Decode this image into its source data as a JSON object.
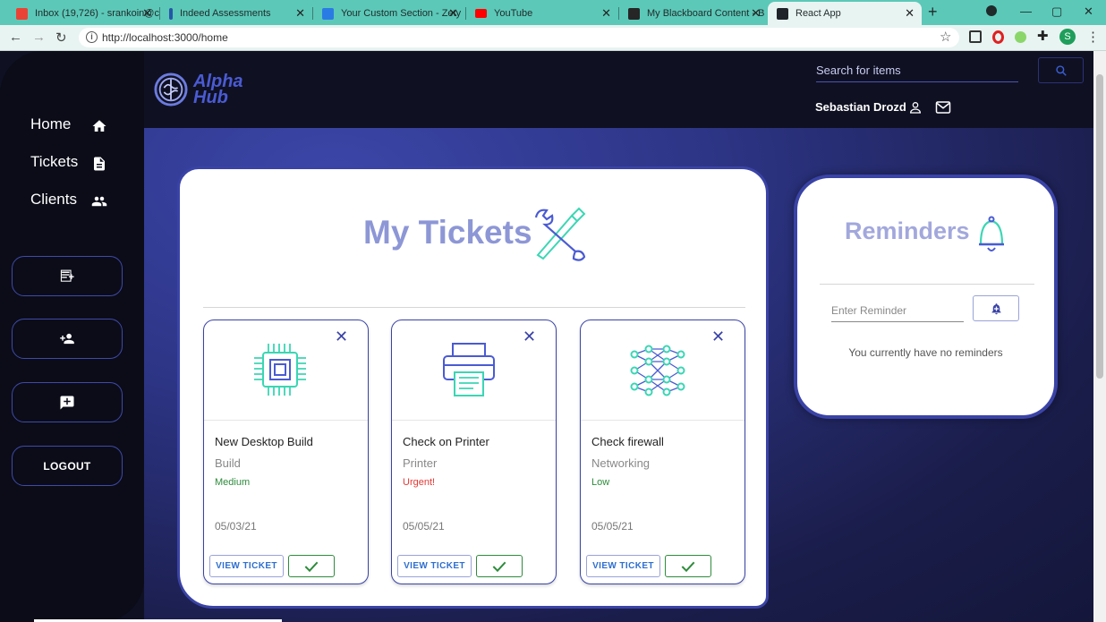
{
  "browser": {
    "tabs": [
      {
        "title": "Inbox (19,726) - srankoin@c",
        "color": "#ea4335"
      },
      {
        "title": "Indeed Assessments",
        "color": "#2557a7"
      },
      {
        "title": "Your Custom Section - Zety",
        "color": "#2b7be4"
      },
      {
        "title": "YouTube",
        "color": "#ff0000"
      },
      {
        "title": "My Blackboard Content - B",
        "color": "#262626"
      },
      {
        "title": "React App",
        "color": "#20232a"
      }
    ],
    "url": "http://localhost:3000/home"
  },
  "sidebar": {
    "items": [
      {
        "label": "Home",
        "icon": "home-icon"
      },
      {
        "label": "Tickets",
        "icon": "document-icon"
      },
      {
        "label": "Clients",
        "icon": "people-icon"
      }
    ],
    "buttons": [
      {
        "icon": "add-note-icon"
      },
      {
        "icon": "add-user-icon"
      },
      {
        "icon": "add-comment-icon"
      }
    ],
    "logout_label": "LOGOUT"
  },
  "header": {
    "logo_line1": "Alpha",
    "logo_line2": "Hub",
    "search_placeholder": "Search for items",
    "user_name": "Sebastian Drozd"
  },
  "tickets": {
    "title": "My Tickets",
    "cards": [
      {
        "title": "New Desktop Build",
        "category": "Build",
        "priority": "Medium",
        "priority_color": "#2e8b3c",
        "date": "05/03/21",
        "image": "cpu-icon"
      },
      {
        "title": "Check on Printer",
        "category": "Printer",
        "priority": "Urgent!",
        "priority_color": "#e53935",
        "date": "05/05/21",
        "image": "printer-icon"
      },
      {
        "title": "Check firewall",
        "category": "Networking",
        "priority": "Low",
        "priority_color": "#2e8b3c",
        "date": "05/05/21",
        "image": "network-icon"
      }
    ],
    "view_label": "VIEW TICKET"
  },
  "reminders": {
    "title": "Reminders",
    "input_placeholder": "Enter Reminder",
    "empty_text": "You currently have no reminders"
  },
  "colors": {
    "accent": "#3a43a6",
    "title": "#8d97d6"
  }
}
